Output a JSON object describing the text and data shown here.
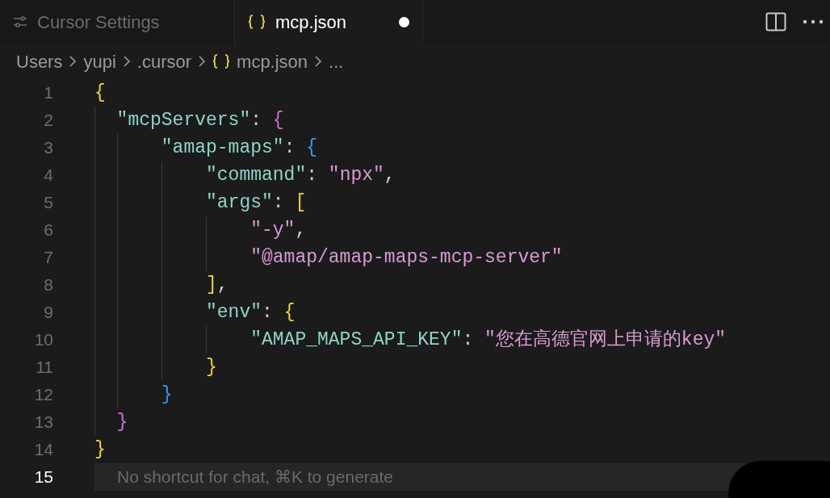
{
  "tabs": [
    {
      "kind": "settings",
      "label": "Cursor Settings",
      "selected": false,
      "modified": false
    },
    {
      "kind": "json",
      "label": "mcp.json",
      "selected": true,
      "modified": true
    }
  ],
  "breadcrumb": [
    {
      "kind": "folder",
      "label": "Users"
    },
    {
      "kind": "folder",
      "label": "yupi"
    },
    {
      "kind": "folder",
      "label": ".cursor"
    },
    {
      "kind": "json",
      "label": "mcp.json"
    },
    {
      "kind": "folder",
      "label": "..."
    }
  ],
  "lines": [
    {
      "number": "1",
      "current": false,
      "tokens": [
        {
          "kind": "open",
          "text": "{",
          "color": "#f1cf3b"
        }
      ]
    },
    {
      "number": "2",
      "current": false,
      "tokens": [
        {
          "kind": "key",
          "text": "\"mcpServers\""
        },
        {
          "kind": "punct",
          "text": ": "
        },
        {
          "kind": "open",
          "text": "{",
          "color": "#d26fd2"
        }
      ]
    },
    {
      "number": "3",
      "current": false,
      "tokens": [
        {
          "kind": "key",
          "text": "\"amap-maps\""
        },
        {
          "kind": "punct",
          "text": ": "
        },
        {
          "kind": "open",
          "text": "{",
          "color": "#3a96f0"
        }
      ]
    },
    {
      "number": "4",
      "current": false,
      "tokens": [
        {
          "kind": "key",
          "text": "\"command\""
        },
        {
          "kind": "punct",
          "text": ": "
        },
        {
          "kind": "string",
          "text": "\"npx\""
        },
        {
          "kind": "punct",
          "text": ","
        }
      ]
    },
    {
      "number": "5",
      "current": false,
      "tokens": [
        {
          "kind": "key",
          "text": "\"args\""
        },
        {
          "kind": "punct",
          "text": ": "
        },
        {
          "kind": "open",
          "text": "[",
          "color": "#f1cf3b"
        }
      ]
    },
    {
      "number": "6",
      "current": false,
      "tokens": [
        {
          "kind": "string",
          "text": "\"-y\""
        },
        {
          "kind": "punct",
          "text": ","
        }
      ]
    },
    {
      "number": "7",
      "current": false,
      "tokens": [
        {
          "kind": "string",
          "text": "\"@amap/amap-maps-mcp-server\""
        }
      ]
    },
    {
      "number": "8",
      "current": false,
      "tokens": [
        {
          "kind": "close",
          "text": "]",
          "color": "#f1cf3b"
        },
        {
          "kind": "punct",
          "text": ","
        }
      ]
    },
    {
      "number": "9",
      "current": false,
      "tokens": [
        {
          "kind": "key",
          "text": "\"env\""
        },
        {
          "kind": "punct",
          "text": ": "
        },
        {
          "kind": "open",
          "text": "{",
          "color": "#f1cf3b"
        }
      ]
    },
    {
      "number": "10",
      "current": false,
      "tokens": [
        {
          "kind": "key",
          "text": "\"AMAP_MAPS_API_KEY\""
        },
        {
          "kind": "punct",
          "text": ": "
        },
        {
          "kind": "string",
          "text": "\"您在高德官网上申请的key\""
        }
      ]
    },
    {
      "number": "11",
      "current": false,
      "tokens": [
        {
          "kind": "close",
          "text": "}",
          "color": "#f1cf3b"
        }
      ]
    },
    {
      "number": "12",
      "current": false,
      "tokens": [
        {
          "kind": "close",
          "text": "}",
          "color": "#3a96f0"
        }
      ]
    },
    {
      "number": "13",
      "current": false,
      "tokens": [
        {
          "kind": "close",
          "text": "}",
          "color": "#d26fd2"
        }
      ]
    },
    {
      "number": "14",
      "current": false,
      "tokens": [
        {
          "kind": "close",
          "text": "}",
          "color": "#f1cf3b"
        }
      ]
    },
    {
      "number": "15",
      "current": true,
      "hint": "No shortcut for chat, ⌘K to generate"
    }
  ]
}
